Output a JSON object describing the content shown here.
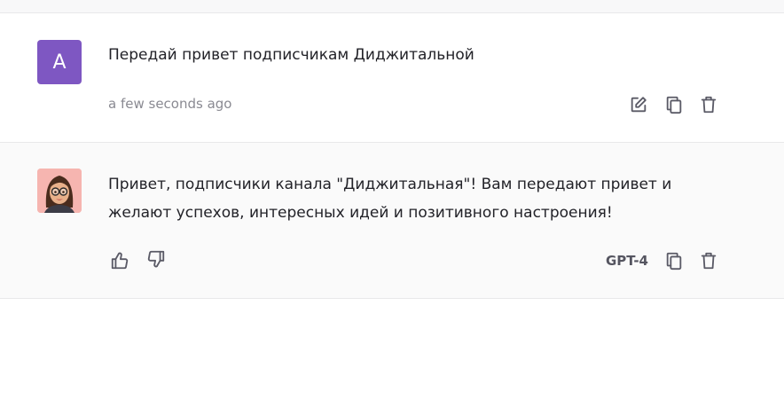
{
  "messages": [
    {
      "role": "user",
      "avatar_letter": "A",
      "avatar_color": "#7e57c2",
      "text": "Передай привет подписчикам Диджитальной",
      "timestamp": "a few seconds ago",
      "actions": [
        "edit-icon",
        "copy-icon",
        "trash-icon"
      ]
    },
    {
      "role": "assistant",
      "avatar": "memoji-avatar",
      "text": "Привет, подписчики канала \"Диджитальная\"! Вам передают привет и желают успехов, интересных идей и позитивного настроения!",
      "model": "GPT-4",
      "actions": [
        "thumbs-up-icon",
        "thumbs-down-icon",
        "copy-icon",
        "trash-icon"
      ]
    }
  ],
  "colors": {
    "icon": "#5a5a66",
    "muted_text": "#8a8a92",
    "divider": "#e8e8ea",
    "assistant_bg": "#fafafa"
  }
}
